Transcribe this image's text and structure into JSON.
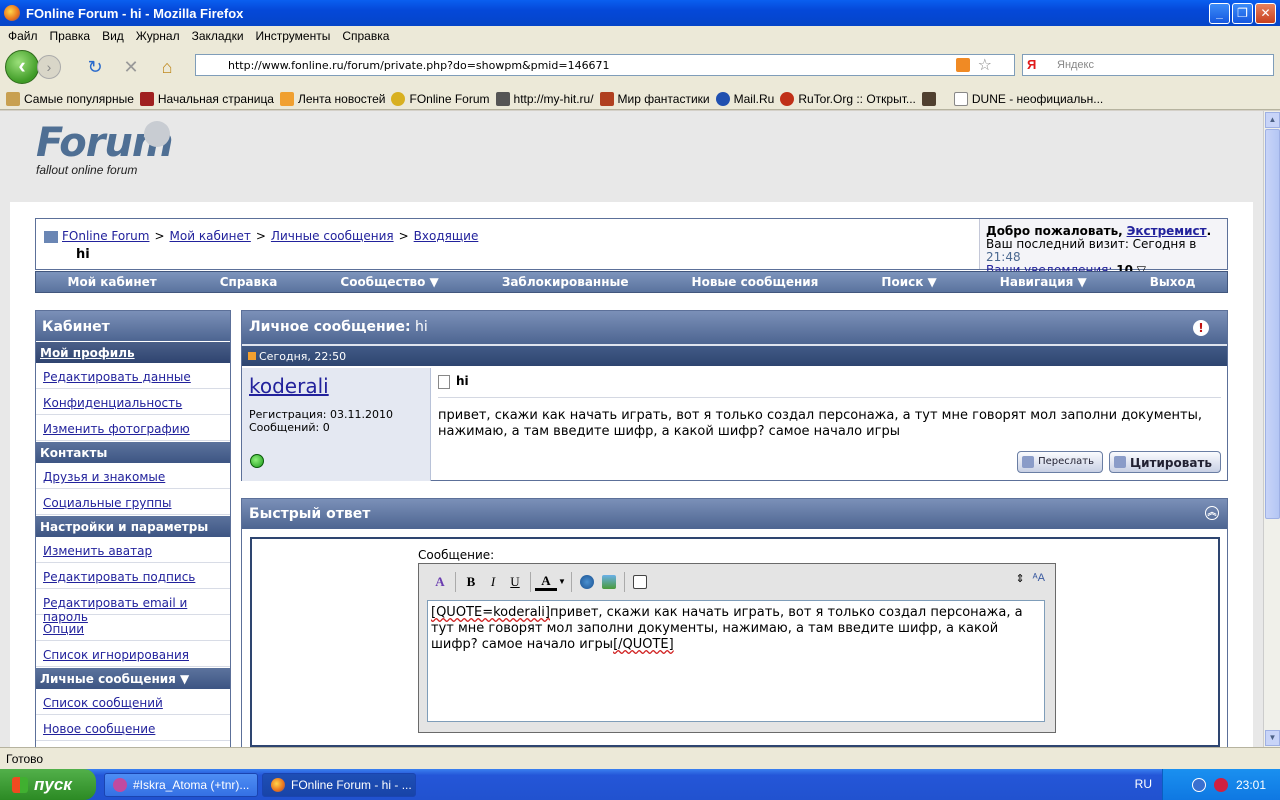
{
  "window": {
    "title": "FOnline Forum - hi - Mozilla Firefox"
  },
  "menu": [
    "Файл",
    "Правка",
    "Вид",
    "Журнал",
    "Закладки",
    "Инструменты",
    "Справка"
  ],
  "nav": {
    "url": "http://www.fonline.ru/forum/private.php?do=showpm&pmid=146671",
    "search_placeholder": "Яндекс",
    "search_engine": "Я"
  },
  "bookmarks": [
    "Самые популярные",
    "Начальная страница",
    "Лента новостей",
    "FOnline Forum",
    "http://my-hit.ru/",
    "Мир фантастики",
    "Mail.Ru",
    "RuTor.Org :: Открыт...",
    "",
    "DUNE - неофициальн..."
  ],
  "logo": {
    "text": "Forum",
    "subtitle": "fallout online forum"
  },
  "breadcrumb": {
    "items": [
      "FOnline Forum",
      "Мой кабинет",
      "Личные сообщения",
      "Входящие"
    ],
    "sep": ">",
    "current": "hi"
  },
  "welcome": {
    "greeting": "Добро пожаловать,",
    "user": "Экстремист",
    "dot": ".",
    "last_visit_label": "Ваш последний визит: Сегодня в",
    "last_visit_time": "21:48",
    "notif_label": "Ваши уведомления:",
    "notif_count": "10"
  },
  "mainnav": [
    "Мой кабинет",
    "Справка",
    "Сообщество ▼",
    "Заблокированные",
    "Новые сообщения",
    "Поиск ▼",
    "Навигация ▼",
    "Выход"
  ],
  "sidebar": {
    "title": "Кабинет",
    "profile": "Мой профиль",
    "profile_items": [
      "Редактировать данные",
      "Конфиденциальность",
      "Изменить фотографию"
    ],
    "contacts": "Контакты",
    "contacts_items": [
      "Друзья и знакомые",
      "Социальные группы"
    ],
    "settings": "Настройки и параметры",
    "settings_items": [
      "Изменить аватар",
      "Редактировать подпись",
      "Редактировать email и пароль",
      "Опции",
      "Список игнорирования"
    ],
    "pm": "Личные сообщения ▼",
    "pm_items": [
      "Список сообщений",
      "Новое сообщение"
    ]
  },
  "pm": {
    "header_label": "Личное сообщение:",
    "header_title": "hi",
    "date": "Сегодня, 22:50",
    "username": "koderali",
    "registration": "Регистрация: 03.11.2010",
    "posts": "Сообщений: 0",
    "title": "hi",
    "text": "привет, скажи как начать играть, вот я только создал персонажа, а тут мне говорят мол заполни документы, нажимаю, а там введите шифр, а какой шифр? самое начало игры",
    "forward": "Переслать",
    "quote": "Цитировать"
  },
  "quickreply": {
    "title": "Быстрый ответ",
    "label": "Сообщение:",
    "text_open": "[QUOTE=koderali]",
    "text_body": "привет, скажи как начать играть, вот я только создал персонажа, а тут мне говорят мол заполни документы, нажимаю, а там введите шифр, а какой шифр? самое начало игры",
    "text_close": "[/QUOTE]"
  },
  "status": "Готово",
  "taskbar": {
    "start": "пуск",
    "tasks": [
      "#Iskra_Atoma (+tnr)...",
      "FOnline Forum - hi - ..."
    ],
    "lang": "RU",
    "time": "23:01"
  }
}
